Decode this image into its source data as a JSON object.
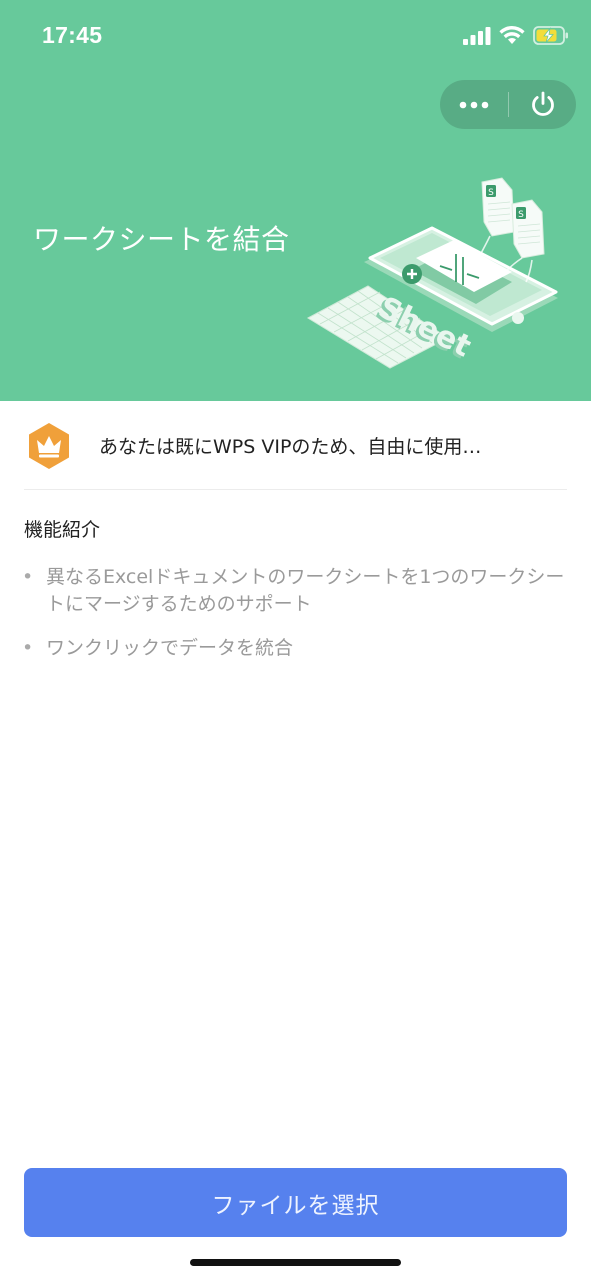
{
  "status_bar": {
    "time": "17:45",
    "icons": [
      "signal-icon",
      "wifi-icon",
      "battery-charging-icon"
    ]
  },
  "capsule": {
    "icons": [
      "more-icon",
      "power-icon"
    ]
  },
  "header": {
    "title": "ワークシートを結合",
    "background_color": "#67c99b",
    "illustration_text": "Sheet"
  },
  "vip": {
    "icon": "crown-icon",
    "icon_color": "#f0a03a",
    "text": "あなたは既にWPS VIPのため、自由に使用…"
  },
  "features": {
    "title": "機能紹介",
    "items": [
      "異なるExcelドキュメントのワークシートを1つのワークシートにマージするためのサポート",
      "ワンクリックでデータを統合"
    ]
  },
  "button": {
    "label": "ファイルを選択",
    "color": "#5681ee"
  }
}
